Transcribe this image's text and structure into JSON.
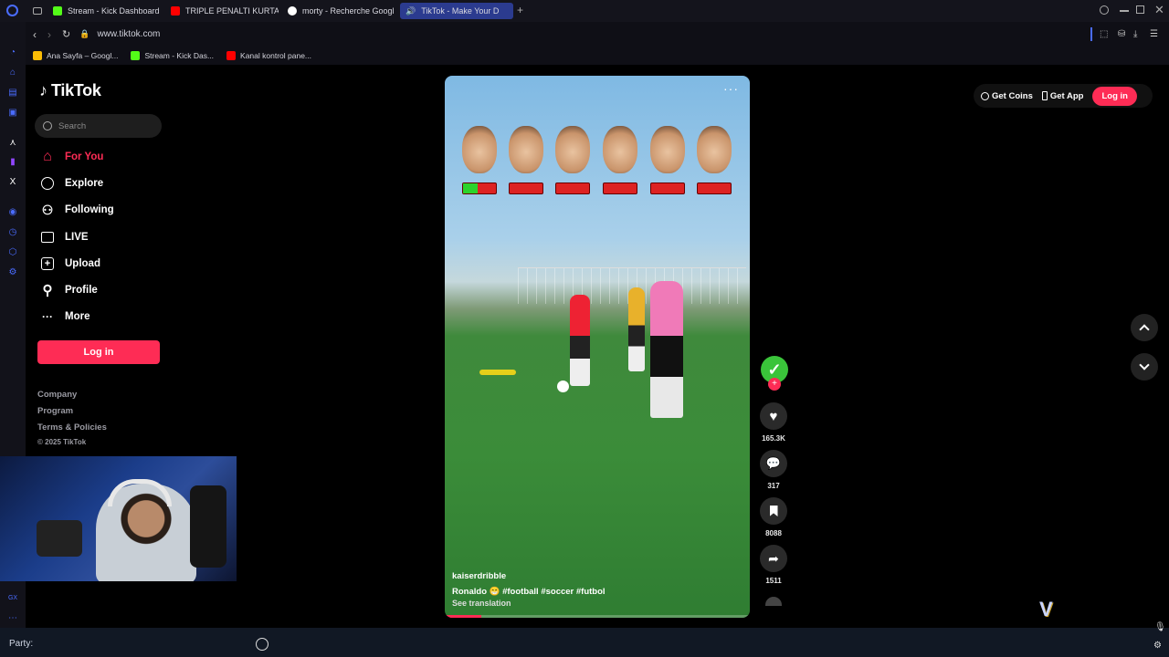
{
  "browser": {
    "tabs": [
      {
        "label": "Stream - Kick Dashboard",
        "favicon_color": "#53fc18"
      },
      {
        "label": "TRIPLE PENALTI KURTAR",
        "favicon_color": "#ff0000"
      },
      {
        "label": "morty - Recherche Googl",
        "favicon_color": "#ffffff"
      },
      {
        "label": "TikTok - Make Your D",
        "favicon_color": "#ffffff",
        "active": true
      }
    ],
    "url": "www.tiktok.com",
    "bookmarks": [
      {
        "label": "Ana Sayfa – Googl...",
        "favicon_color": "#fbbc05"
      },
      {
        "label": "Stream - Kick Das...",
        "favicon_color": "#53fc18"
      },
      {
        "label": "Kanal kontrol pane...",
        "favicon_color": "#ff0000"
      }
    ]
  },
  "tiktok": {
    "logo": "TikTok",
    "search_placeholder": "Search",
    "nav": [
      {
        "label": "For You",
        "icon": "home-icon",
        "active": true
      },
      {
        "label": "Explore",
        "icon": "compass-icon"
      },
      {
        "label": "Following",
        "icon": "following-icon"
      },
      {
        "label": "LIVE",
        "icon": "live-icon"
      },
      {
        "label": "Upload",
        "icon": "upload-icon"
      },
      {
        "label": "Profile",
        "icon": "profile-icon"
      },
      {
        "label": "More",
        "icon": "more-icon"
      }
    ],
    "login_label": "Log in",
    "footer": {
      "company": "Company",
      "program": "Program",
      "terms": "Terms & Policies",
      "copyright": "© 2025 TikTok"
    },
    "top_right": {
      "get_coins": "Get Coins",
      "get_app": "Get App",
      "login": "Log in"
    },
    "video": {
      "author": "kaiserdribble",
      "caption": "Ronaldo 😁 #football #soccer #futbol",
      "see_translation": "See translation",
      "menu_icon": "more-dots-icon",
      "progress": 0.12,
      "health_bars": [
        0.45,
        0,
        0,
        0,
        0,
        0
      ]
    },
    "actions": {
      "likes": "165.3K",
      "comments": "317",
      "bookmarks": "8088",
      "shares": "1511"
    }
  },
  "bottom": {
    "party_label": "Party:"
  },
  "colors": {
    "accent": "#fe2c55",
    "active_tab": "#2b3b8f"
  }
}
